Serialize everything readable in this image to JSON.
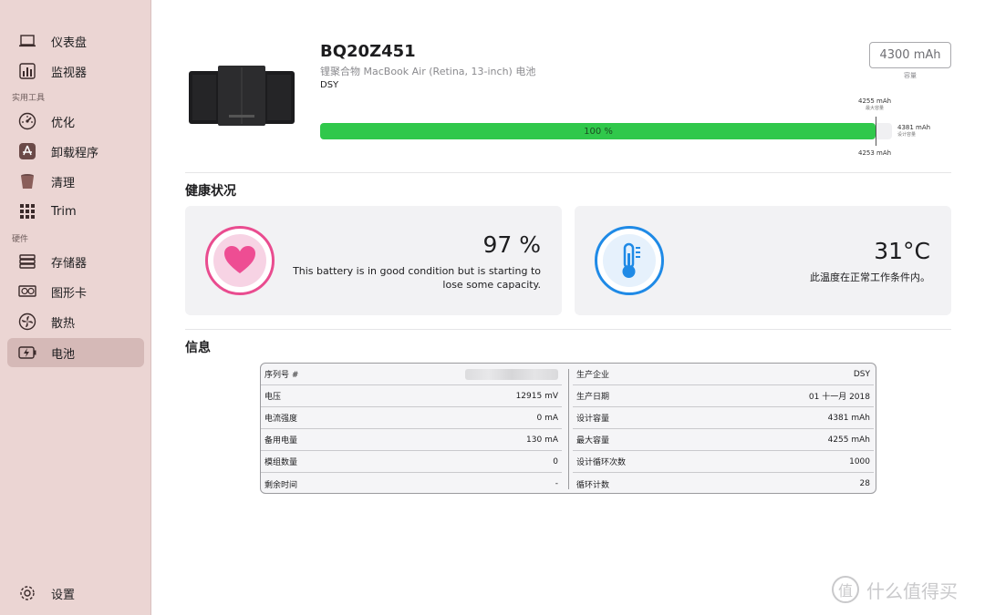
{
  "sidebar": {
    "items": [
      {
        "label": "仪表盘",
        "icon": "laptop-icon"
      },
      {
        "label": "监视器",
        "icon": "monitor-chart-icon"
      },
      {
        "label": "优化",
        "icon": "gauge-icon"
      },
      {
        "label": "卸载程序",
        "icon": "app-store-icon"
      },
      {
        "label": "清理",
        "icon": "trash-bin-icon"
      },
      {
        "label": "Trim",
        "icon": "grid-dots-icon"
      },
      {
        "label": "存储器",
        "icon": "storage-stack-icon"
      },
      {
        "label": "图形卡",
        "icon": "graphics-card-icon"
      },
      {
        "label": "散热",
        "icon": "fan-icon"
      },
      {
        "label": "电池",
        "icon": "battery-bolt-icon"
      }
    ],
    "sections": {
      "tools": "实用工具",
      "hardware": "硬件"
    },
    "settings_label": "设置",
    "active": "电池"
  },
  "header": {
    "model": "BQ20Z451",
    "description": "锂聚合物 MacBook Air (Retina, 13-inch) 电池",
    "manufacturer": "DSY",
    "capacity_value": "4300 mAh",
    "capacity_label": "容量"
  },
  "charge_bar": {
    "percent_text": "100 %",
    "fill_fraction": 0.972,
    "max_capacity": "4255 mAh",
    "max_capacity_label": "最大容量",
    "design_capacity": "4381 mAh",
    "design_capacity_label": "设计容量",
    "current_capacity": "4253 mAh"
  },
  "health": {
    "section_title": "健康状况",
    "battery": {
      "value": "97 %",
      "desc_line1": "This battery is in good condition but is starting to",
      "desc_line2": "lose some capacity."
    },
    "temperature": {
      "value": "31°C",
      "desc": "此温度在正常工作条件内。"
    }
  },
  "info": {
    "section_title": "信息",
    "left": [
      {
        "label": "序列号 #",
        "value": ""
      },
      {
        "label": "电压",
        "value": "12915 mV"
      },
      {
        "label": "电流强度",
        "value": "0 mA"
      },
      {
        "label": "备用电量",
        "value": "130 mA"
      },
      {
        "label": "模组数量",
        "value": "0"
      },
      {
        "label": "剩余时间",
        "value": "-"
      }
    ],
    "right": [
      {
        "label": "生产企业",
        "value": "DSY"
      },
      {
        "label": "生产日期",
        "value": "01 十一月 2018"
      },
      {
        "label": "设计容量",
        "value": "4381 mAh"
      },
      {
        "label": "最大容量",
        "value": "4255 mAh"
      },
      {
        "label": "设计循环次数",
        "value": "1000"
      },
      {
        "label": "循环计数",
        "value": "28"
      }
    ]
  },
  "watermark": "什么值得买",
  "colors": {
    "sidebar_bg": "#ebd5d3",
    "active_bg": "#d5b9b7",
    "bar_green": "#30c84b",
    "heart_pink": "#e94c8f",
    "thermo_blue": "#1f8ae6"
  }
}
